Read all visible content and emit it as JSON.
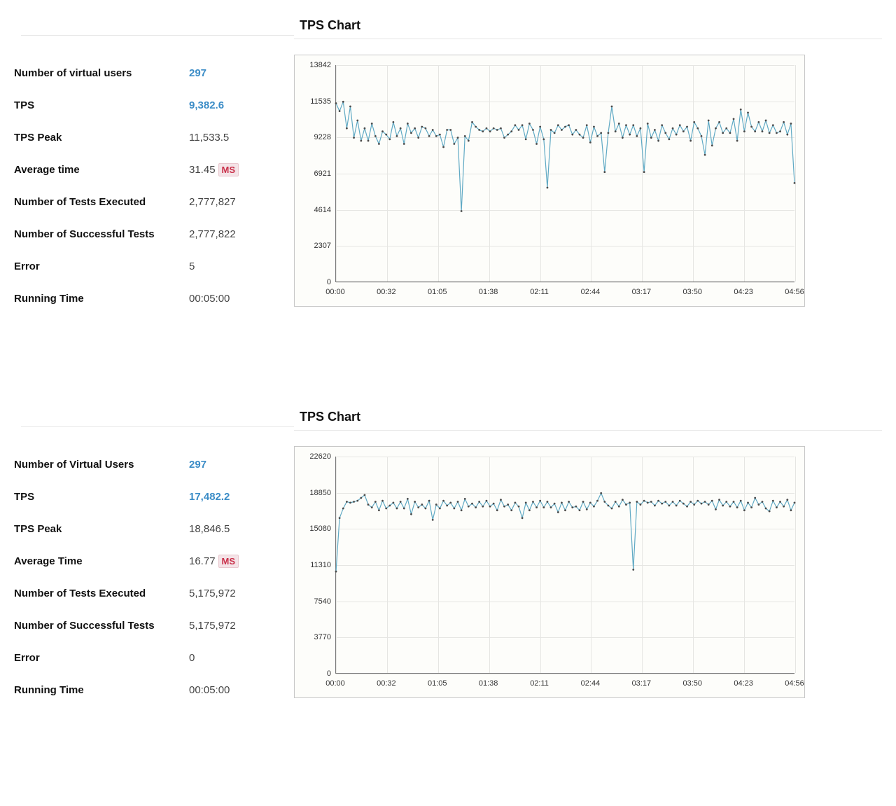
{
  "blocks": [
    {
      "chart_title": "TPS Chart",
      "stats": [
        {
          "label": "Number of virtual users",
          "value": "297",
          "blue": true
        },
        {
          "label": "TPS",
          "value": "9,382.6",
          "blue": true
        },
        {
          "label": "TPS Peak",
          "value": "11,533.5"
        },
        {
          "label": "Average time",
          "value": "31.45",
          "badge": "MS"
        },
        {
          "label": "Number of Tests Executed",
          "value": "2,777,827"
        },
        {
          "label": "Number of Successful Tests",
          "value": "2,777,822"
        },
        {
          "label": "Error",
          "value": "5"
        },
        {
          "label": "Running Time",
          "value": "00:05:00"
        }
      ]
    },
    {
      "chart_title": "TPS Chart",
      "stats": [
        {
          "label": "Number of Virtual Users",
          "value": "297",
          "blue": true
        },
        {
          "label": "TPS",
          "value": "17,482.2",
          "blue": true
        },
        {
          "label": "TPS Peak",
          "value": "18,846.5"
        },
        {
          "label": "Average Time",
          "value": "16.77",
          "badge": "MS"
        },
        {
          "label": "Number of Tests Executed",
          "value": "5,175,972"
        },
        {
          "label": "Number of Successful Tests",
          "value": "5,175,972"
        },
        {
          "label": "Error",
          "value": "0"
        },
        {
          "label": "Running Time",
          "value": "00:05:00"
        }
      ]
    }
  ],
  "chart_data": [
    {
      "type": "line",
      "title": "TPS Chart",
      "xlabel": "",
      "ylabel": "",
      "ylim": [
        0,
        13842
      ],
      "y_ticks": [
        0,
        2307,
        4614,
        6921,
        9228,
        11535,
        13842
      ],
      "x_ticks": [
        "00:00",
        "00:32",
        "01:05",
        "01:38",
        "02:11",
        "02:44",
        "03:17",
        "03:50",
        "04:23",
        "04:56"
      ],
      "series": [
        {
          "name": "TPS",
          "values": [
            11400,
            10900,
            11500,
            9800,
            11200,
            9200,
            10300,
            9000,
            9800,
            9000,
            10100,
            9300,
            8800,
            9600,
            9400,
            9100,
            10200,
            9300,
            9800,
            8800,
            10100,
            9500,
            9800,
            9200,
            9900,
            9800,
            9300,
            9700,
            9300,
            9400,
            8600,
            9700,
            9700,
            8800,
            9200,
            4500,
            9300,
            9000,
            10200,
            9900,
            9700,
            9600,
            9800,
            9600,
            9800,
            9700,
            9800,
            9200,
            9400,
            9600,
            10000,
            9700,
            10000,
            9100,
            10100,
            9700,
            8800,
            9900,
            9100,
            6000,
            9700,
            9500,
            10000,
            9700,
            9900,
            10000,
            9400,
            9700,
            9400,
            9200,
            10000,
            8900,
            9900,
            9300,
            9500,
            7000,
            9500,
            11200,
            9600,
            10100,
            9200,
            10000,
            9400,
            10000,
            9300,
            9800,
            7000,
            10100,
            9200,
            9700,
            9000,
            10000,
            9500,
            9100,
            9800,
            9400,
            10000,
            9600,
            9900,
            9000,
            10200,
            9800,
            9300,
            8100,
            10300,
            8700,
            9800,
            10200,
            9500,
            9800,
            9500,
            10400,
            9000,
            11000,
            9600,
            10800,
            9900,
            9600,
            10200,
            9600,
            10300,
            9500,
            10000,
            9500,
            9600,
            10200,
            9400,
            10100,
            6300
          ]
        }
      ]
    },
    {
      "type": "line",
      "title": "TPS Chart",
      "xlabel": "",
      "ylabel": "",
      "ylim": [
        0,
        22620
      ],
      "y_ticks": [
        0,
        3770,
        7540,
        11310,
        15080,
        18850,
        22620
      ],
      "x_ticks": [
        "00:00",
        "00:32",
        "01:05",
        "01:38",
        "02:11",
        "02:44",
        "03:17",
        "03:50",
        "04:23",
        "04:56"
      ],
      "series": [
        {
          "name": "TPS",
          "values": [
            10600,
            16200,
            17200,
            17900,
            17800,
            17900,
            18000,
            18300,
            18600,
            17600,
            17300,
            17900,
            17000,
            18000,
            17200,
            17500,
            17800,
            17200,
            17900,
            17200,
            18200,
            16600,
            17900,
            17300,
            17600,
            17200,
            18000,
            16000,
            17600,
            17200,
            18000,
            17500,
            17800,
            17200,
            17900,
            17000,
            18200,
            17400,
            17700,
            17300,
            17900,
            17400,
            18000,
            17400,
            17700,
            17000,
            18100,
            17400,
            17600,
            17000,
            17800,
            17400,
            16200,
            17800,
            17000,
            17900,
            17300,
            18000,
            17300,
            17900,
            17300,
            17700,
            16800,
            17800,
            17000,
            17900,
            17300,
            17400,
            17000,
            17900,
            17100,
            17800,
            17400,
            18000,
            18800,
            17900,
            17500,
            17200,
            17900,
            17400,
            18100,
            17600,
            17800,
            10800,
            17900,
            17600,
            18000,
            17800,
            17900,
            17500,
            18000,
            17700,
            17900,
            17500,
            17900,
            17500,
            18000,
            17700,
            17400,
            17900,
            17600,
            18000,
            17700,
            17900,
            17600,
            18000,
            17100,
            18100,
            17500,
            17900,
            17400,
            17900,
            17300,
            18000,
            17000,
            17800,
            17300,
            18300,
            17600,
            17900,
            17200,
            16900,
            18000,
            17300,
            17900,
            17400,
            18100,
            17000,
            17800
          ]
        }
      ]
    }
  ]
}
